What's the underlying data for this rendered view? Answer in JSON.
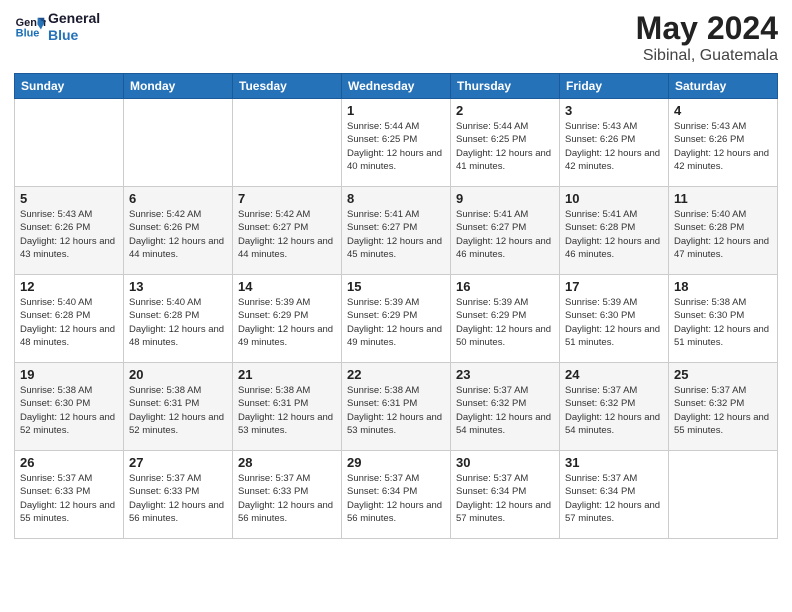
{
  "logo": {
    "line1": "General",
    "line2": "Blue"
  },
  "title": "May 2024",
  "subtitle": "Sibinal, Guatemala",
  "weekdays": [
    "Sunday",
    "Monday",
    "Tuesday",
    "Wednesday",
    "Thursday",
    "Friday",
    "Saturday"
  ],
  "weeks": [
    [
      {
        "num": "",
        "info": ""
      },
      {
        "num": "",
        "info": ""
      },
      {
        "num": "",
        "info": ""
      },
      {
        "num": "1",
        "info": "Sunrise: 5:44 AM\nSunset: 6:25 PM\nDaylight: 12 hours\nand 40 minutes."
      },
      {
        "num": "2",
        "info": "Sunrise: 5:44 AM\nSunset: 6:25 PM\nDaylight: 12 hours\nand 41 minutes."
      },
      {
        "num": "3",
        "info": "Sunrise: 5:43 AM\nSunset: 6:26 PM\nDaylight: 12 hours\nand 42 minutes."
      },
      {
        "num": "4",
        "info": "Sunrise: 5:43 AM\nSunset: 6:26 PM\nDaylight: 12 hours\nand 42 minutes."
      }
    ],
    [
      {
        "num": "5",
        "info": "Sunrise: 5:43 AM\nSunset: 6:26 PM\nDaylight: 12 hours\nand 43 minutes."
      },
      {
        "num": "6",
        "info": "Sunrise: 5:42 AM\nSunset: 6:26 PM\nDaylight: 12 hours\nand 44 minutes."
      },
      {
        "num": "7",
        "info": "Sunrise: 5:42 AM\nSunset: 6:27 PM\nDaylight: 12 hours\nand 44 minutes."
      },
      {
        "num": "8",
        "info": "Sunrise: 5:41 AM\nSunset: 6:27 PM\nDaylight: 12 hours\nand 45 minutes."
      },
      {
        "num": "9",
        "info": "Sunrise: 5:41 AM\nSunset: 6:27 PM\nDaylight: 12 hours\nand 46 minutes."
      },
      {
        "num": "10",
        "info": "Sunrise: 5:41 AM\nSunset: 6:28 PM\nDaylight: 12 hours\nand 46 minutes."
      },
      {
        "num": "11",
        "info": "Sunrise: 5:40 AM\nSunset: 6:28 PM\nDaylight: 12 hours\nand 47 minutes."
      }
    ],
    [
      {
        "num": "12",
        "info": "Sunrise: 5:40 AM\nSunset: 6:28 PM\nDaylight: 12 hours\nand 48 minutes."
      },
      {
        "num": "13",
        "info": "Sunrise: 5:40 AM\nSunset: 6:28 PM\nDaylight: 12 hours\nand 48 minutes."
      },
      {
        "num": "14",
        "info": "Sunrise: 5:39 AM\nSunset: 6:29 PM\nDaylight: 12 hours\nand 49 minutes."
      },
      {
        "num": "15",
        "info": "Sunrise: 5:39 AM\nSunset: 6:29 PM\nDaylight: 12 hours\nand 49 minutes."
      },
      {
        "num": "16",
        "info": "Sunrise: 5:39 AM\nSunset: 6:29 PM\nDaylight: 12 hours\nand 50 minutes."
      },
      {
        "num": "17",
        "info": "Sunrise: 5:39 AM\nSunset: 6:30 PM\nDaylight: 12 hours\nand 51 minutes."
      },
      {
        "num": "18",
        "info": "Sunrise: 5:38 AM\nSunset: 6:30 PM\nDaylight: 12 hours\nand 51 minutes."
      }
    ],
    [
      {
        "num": "19",
        "info": "Sunrise: 5:38 AM\nSunset: 6:30 PM\nDaylight: 12 hours\nand 52 minutes."
      },
      {
        "num": "20",
        "info": "Sunrise: 5:38 AM\nSunset: 6:31 PM\nDaylight: 12 hours\nand 52 minutes."
      },
      {
        "num": "21",
        "info": "Sunrise: 5:38 AM\nSunset: 6:31 PM\nDaylight: 12 hours\nand 53 minutes."
      },
      {
        "num": "22",
        "info": "Sunrise: 5:38 AM\nSunset: 6:31 PM\nDaylight: 12 hours\nand 53 minutes."
      },
      {
        "num": "23",
        "info": "Sunrise: 5:37 AM\nSunset: 6:32 PM\nDaylight: 12 hours\nand 54 minutes."
      },
      {
        "num": "24",
        "info": "Sunrise: 5:37 AM\nSunset: 6:32 PM\nDaylight: 12 hours\nand 54 minutes."
      },
      {
        "num": "25",
        "info": "Sunrise: 5:37 AM\nSunset: 6:32 PM\nDaylight: 12 hours\nand 55 minutes."
      }
    ],
    [
      {
        "num": "26",
        "info": "Sunrise: 5:37 AM\nSunset: 6:33 PM\nDaylight: 12 hours\nand 55 minutes."
      },
      {
        "num": "27",
        "info": "Sunrise: 5:37 AM\nSunset: 6:33 PM\nDaylight: 12 hours\nand 56 minutes."
      },
      {
        "num": "28",
        "info": "Sunrise: 5:37 AM\nSunset: 6:33 PM\nDaylight: 12 hours\nand 56 minutes."
      },
      {
        "num": "29",
        "info": "Sunrise: 5:37 AM\nSunset: 6:34 PM\nDaylight: 12 hours\nand 56 minutes."
      },
      {
        "num": "30",
        "info": "Sunrise: 5:37 AM\nSunset: 6:34 PM\nDaylight: 12 hours\nand 57 minutes."
      },
      {
        "num": "31",
        "info": "Sunrise: 5:37 AM\nSunset: 6:34 PM\nDaylight: 12 hours\nand 57 minutes."
      },
      {
        "num": "",
        "info": ""
      }
    ]
  ]
}
